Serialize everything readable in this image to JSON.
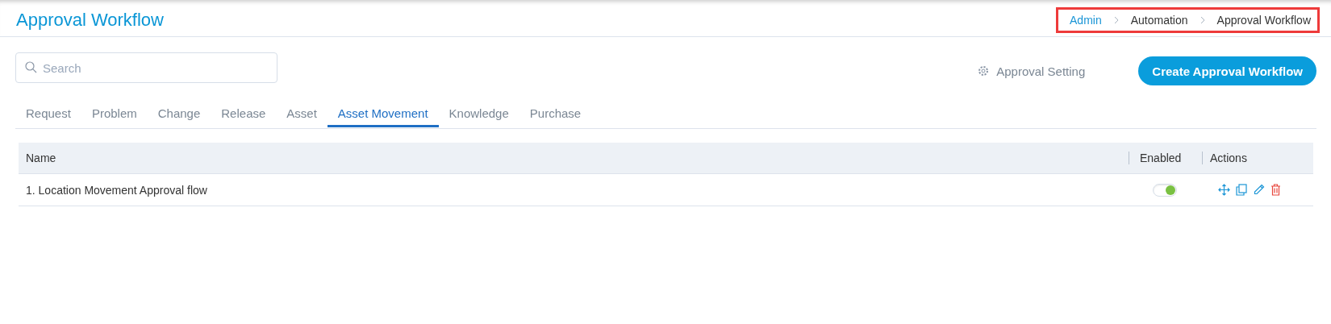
{
  "page": {
    "title": "Approval Workflow"
  },
  "breadcrumb": [
    {
      "label": "Admin",
      "kind": "link"
    },
    {
      "label": "Automation",
      "kind": "text"
    },
    {
      "label": "Approval Workflow",
      "kind": "text"
    }
  ],
  "search": {
    "placeholder": "Search"
  },
  "settings_link": "Approval Setting",
  "create_button": "Create Approval Workflow",
  "tabs": [
    {
      "label": "Request",
      "selected": false
    },
    {
      "label": "Problem",
      "selected": false
    },
    {
      "label": "Change",
      "selected": false
    },
    {
      "label": "Release",
      "selected": false
    },
    {
      "label": "Asset",
      "selected": false
    },
    {
      "label": "Asset Movement",
      "selected": true
    },
    {
      "label": "Knowledge",
      "selected": false
    },
    {
      "label": "Purchase",
      "selected": false
    }
  ],
  "table": {
    "columns": [
      "Name",
      "Enabled",
      "Actions"
    ],
    "rows": [
      {
        "name": "1. Location Movement Approval flow",
        "enabled": true
      }
    ]
  }
}
